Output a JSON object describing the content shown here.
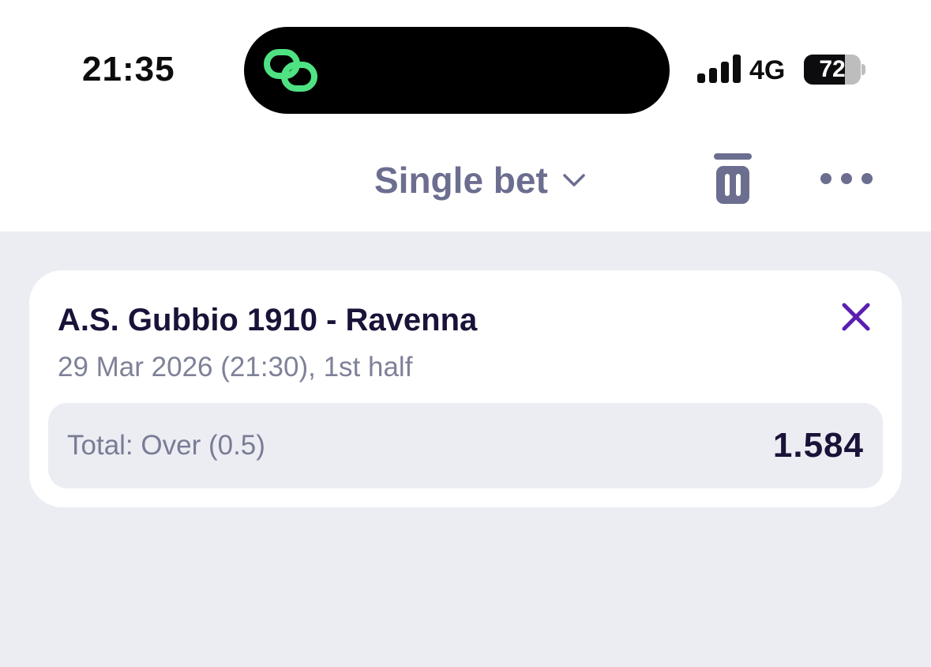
{
  "status_bar": {
    "time": "21:35",
    "network": "4G",
    "battery_level": "72",
    "battery_fraction": 0.72,
    "signal_bars": 4,
    "island_icon": "link-rings-icon",
    "island_icon_color": "#4ee283"
  },
  "header": {
    "bet_type": "Single bet",
    "icons": [
      "chevron-down-icon",
      "trash-icon",
      "more-icon"
    ],
    "icon_color": "#6c6e90"
  },
  "bet_card": {
    "event": "A.S. Gubbio 1910 - Ravenna",
    "date": "29 Mar 2026 (21:30), 1st half",
    "selection": "Total: Over (0.5)",
    "odds": "1.584",
    "close_icon": "close-icon",
    "accent_color": "#5a1fb0"
  }
}
